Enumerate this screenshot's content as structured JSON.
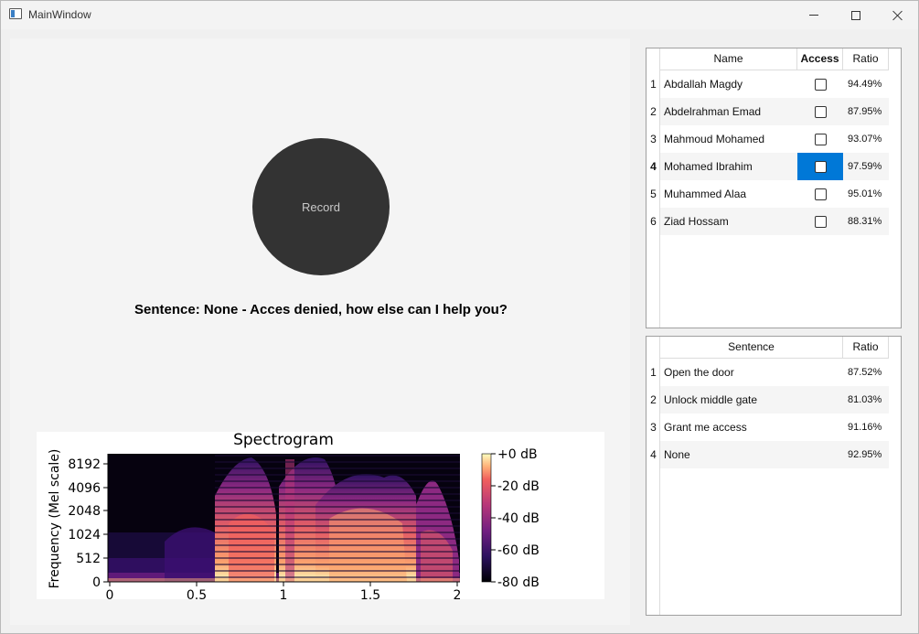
{
  "window": {
    "title": "MainWindow"
  },
  "record": {
    "label": "Record"
  },
  "status": {
    "sentence": "Sentence: None - Acces denied, how else can I help you?"
  },
  "spectrogram": {
    "title": "Spectrogram",
    "ylabel": "Frequency (Mel scale)",
    "y_ticks": [
      "8192",
      "4096",
      "2048",
      "1024",
      "512",
      "0"
    ],
    "x_ticks": [
      "0",
      "0.5",
      "1",
      "1.5",
      "2"
    ],
    "colorbar_ticks": [
      "+0 dB",
      "-20 dB",
      "-40 dB",
      "-60 dB",
      "-80 dB"
    ]
  },
  "chart_data": {
    "type": "heatmap",
    "title": "Spectrogram",
    "xlabel": "",
    "ylabel": "Frequency (Mel scale)",
    "xlim": [
      0,
      2
    ],
    "y_ticks": [
      0,
      512,
      1024,
      2048,
      4096,
      8192
    ],
    "colorbar": {
      "range_db": [
        -80,
        0
      ],
      "ticks_db": [
        0,
        -20,
        -40,
        -60,
        -80
      ]
    },
    "colormap": "magma"
  },
  "users_table": {
    "headers": [
      "Name",
      "Access",
      "Ratio"
    ],
    "rows": [
      {
        "num": "1",
        "name": "Abdallah Magdy",
        "access": false,
        "ratio": "94.49%"
      },
      {
        "num": "2",
        "name": "Abdelrahman Emad",
        "access": false,
        "ratio": "87.95%"
      },
      {
        "num": "3",
        "name": "Mahmoud Mohamed",
        "access": false,
        "ratio": "93.07%"
      },
      {
        "num": "4",
        "name": "Mohamed Ibrahim",
        "access": false,
        "ratio": "97.59%"
      },
      {
        "num": "5",
        "name": "Muhammed Alaa",
        "access": false,
        "ratio": "95.01%"
      },
      {
        "num": "6",
        "name": "Ziad Hossam",
        "access": false,
        "ratio": "88.31%"
      }
    ],
    "selected_row": "4"
  },
  "sentences_table": {
    "headers": [
      "Sentence",
      "Ratio"
    ],
    "rows": [
      {
        "num": "1",
        "sentence": "Open the door",
        "ratio": "87.52%"
      },
      {
        "num": "2",
        "sentence": "Unlock middle gate",
        "ratio": "81.03%"
      },
      {
        "num": "3",
        "sentence": "Grant me access",
        "ratio": "91.16%"
      },
      {
        "num": "4",
        "sentence": "None",
        "ratio": "92.95%"
      }
    ]
  },
  "colors": {
    "record_button": "#333333",
    "selection": "#0078d7",
    "panel_bg": "#f4f4f4"
  }
}
